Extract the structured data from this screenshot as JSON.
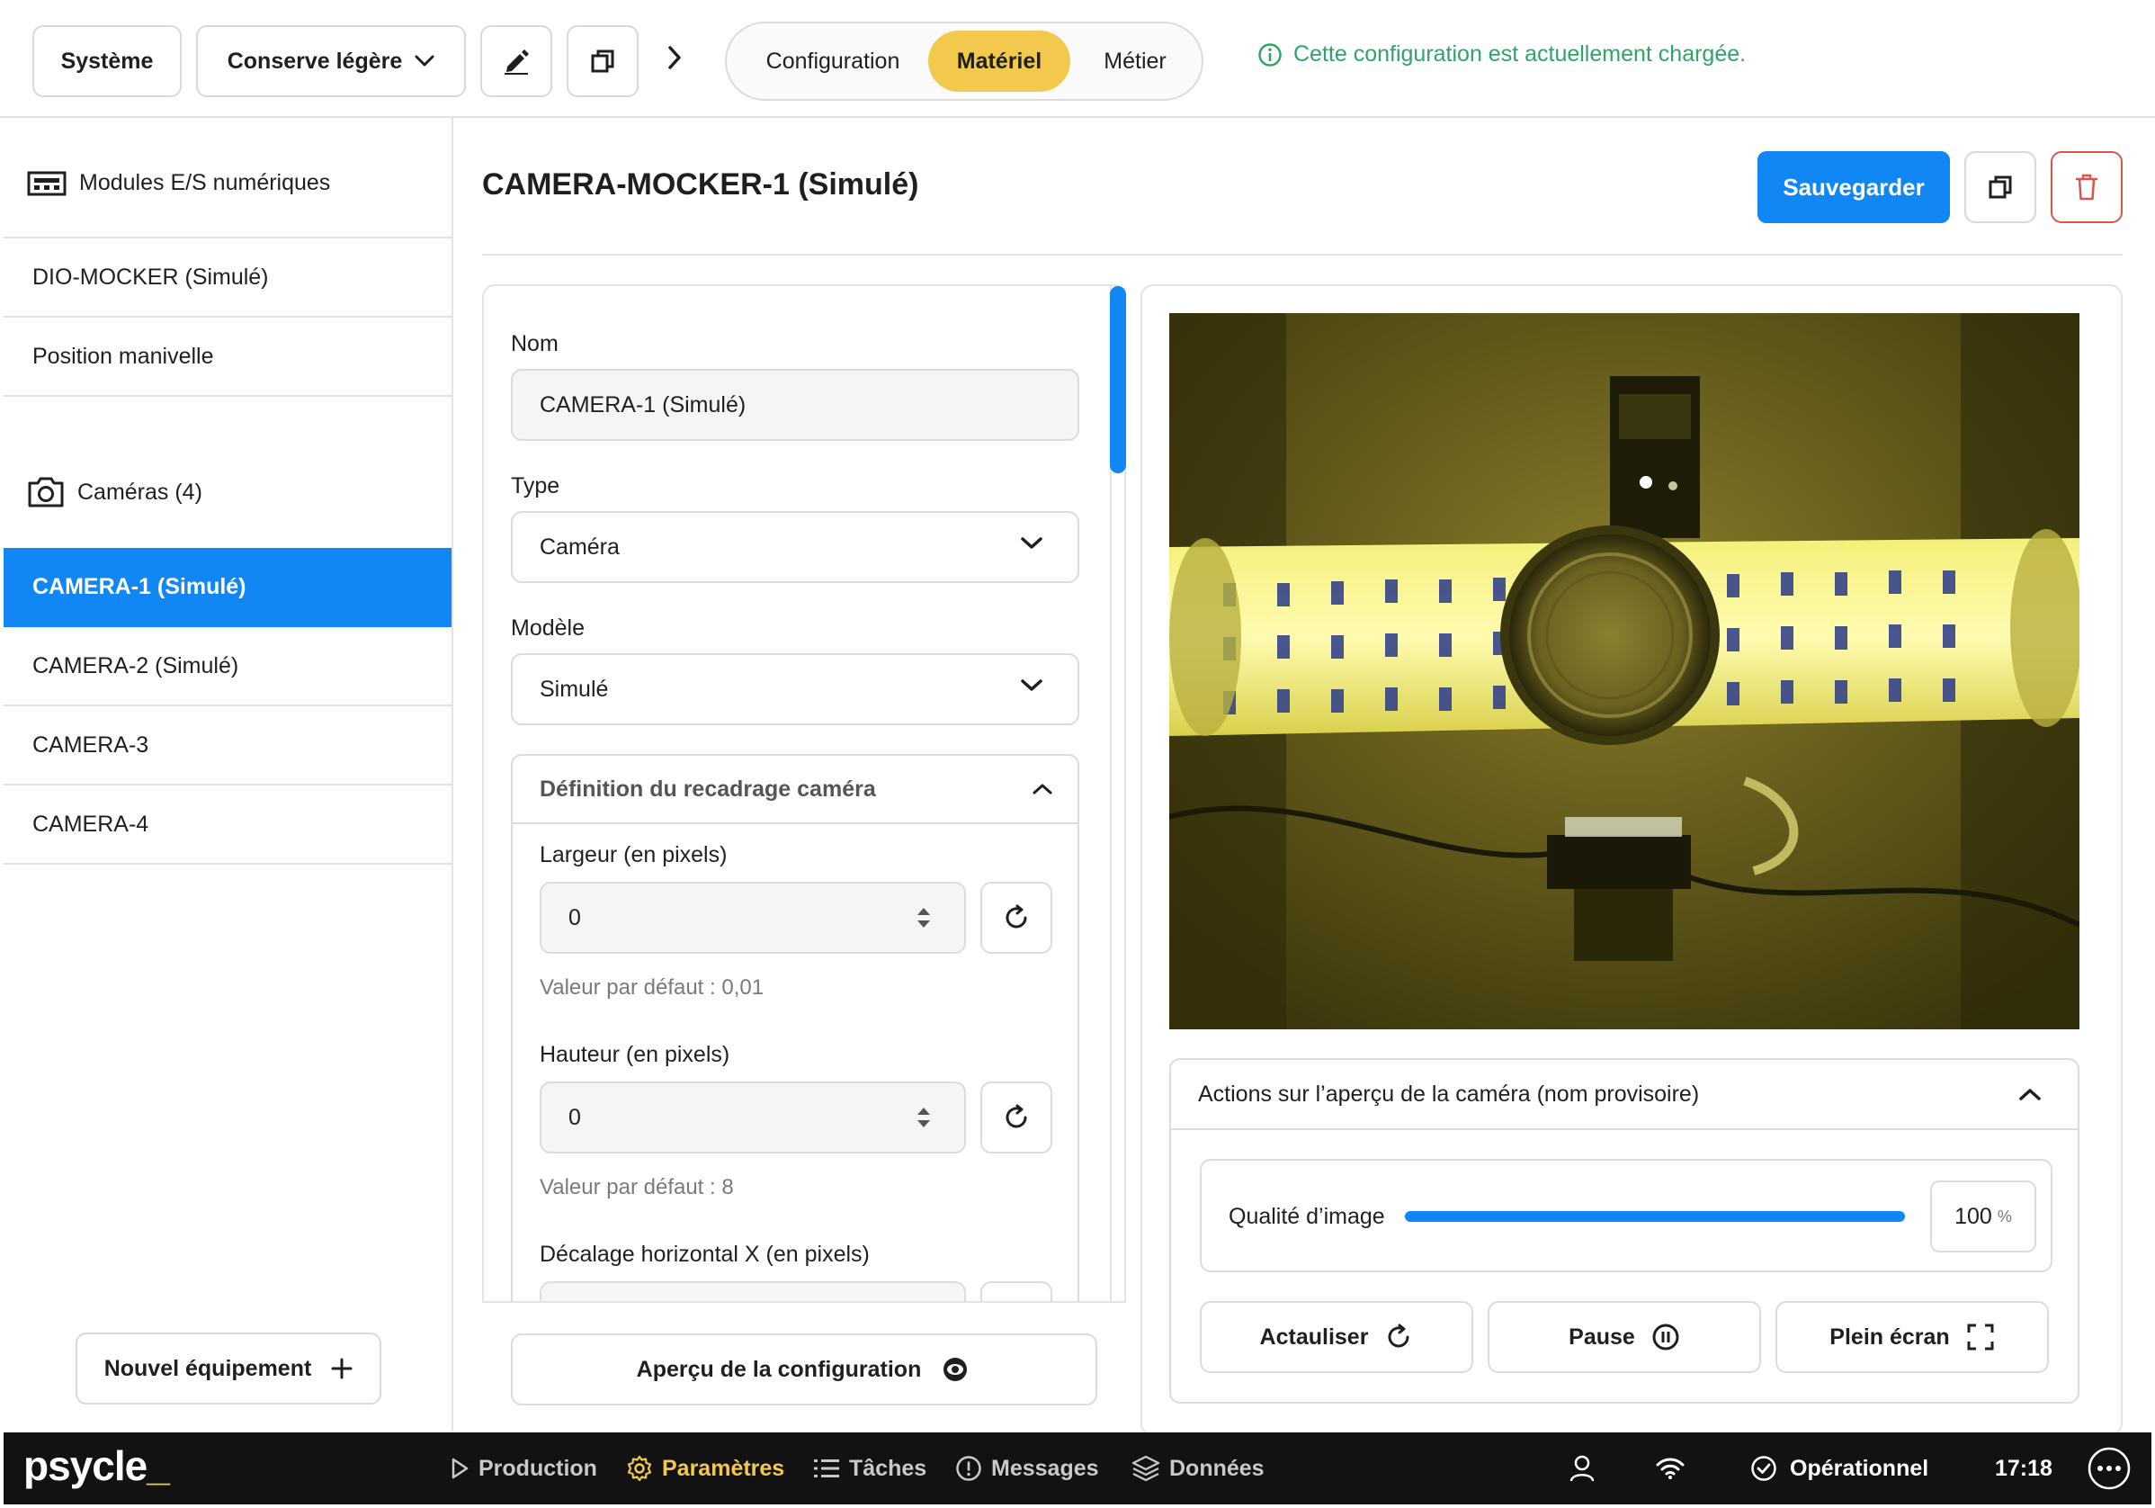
{
  "topbar": {
    "system_label": "Système",
    "config_select": "Conserve légère",
    "tabs": [
      {
        "label": "Configuration",
        "active": false
      },
      {
        "label": "Matériel",
        "active": true
      },
      {
        "label": "Métier",
        "active": false
      }
    ],
    "status_message": "Cette configuration est actuellement chargée."
  },
  "sidebar": {
    "section_io": "Modules E/S numériques",
    "io_items": [
      "DIO-MOCKER (Simulé)",
      "Position manivelle"
    ],
    "section_cameras": "Caméras (4)",
    "camera_items": [
      {
        "label": "CAMERA-1 (Simulé)",
        "active": true
      },
      {
        "label": "CAMERA-2 (Simulé)",
        "active": false
      },
      {
        "label": "CAMERA-3",
        "active": false
      },
      {
        "label": "CAMERA-4",
        "active": false
      }
    ],
    "new_equipment": "Nouvel équipement"
  },
  "main": {
    "title": "CAMERA-MOCKER-1 (Simulé)",
    "save_label": "Sauvegarder"
  },
  "form": {
    "name_label": "Nom",
    "name_value": "CAMERA-1 (Simulé)",
    "type_label": "Type",
    "type_value": "Caméra",
    "model_label": "Modèle",
    "model_value": "Simulé",
    "crop_section": "Définition du recadrage caméra",
    "width_label": "Largeur (en pixels)",
    "width_value": "0",
    "width_default": "Valeur par défaut : 0,01",
    "height_label": "Hauteur (en pixels)",
    "height_value": "0",
    "height_default": "Valeur par défaut : 8",
    "offset_x_label": "Décalage horizontal X (en pixels)",
    "preview_label": "Aperçu de la configuration"
  },
  "camera": {
    "actions_title": "Actions sur l’aperçu de la caméra (nom provisoire)",
    "quality_label": "Qualité d’image",
    "quality_value": "100",
    "quality_unit": "%",
    "quality_fraction": 1.0,
    "refresh_label": "Actauliser",
    "pause_label": "Pause",
    "fullscreen_label": "Plein écran"
  },
  "bottombar": {
    "logo": "psycle",
    "nav": [
      {
        "label": "Production",
        "icon": "play-icon",
        "active": false
      },
      {
        "label": "Paramètres",
        "icon": "gear-icon",
        "active": true
      },
      {
        "label": "Tâches",
        "icon": "list-icon",
        "active": false
      },
      {
        "label": "Messages",
        "icon": "alert-circle-icon",
        "active": false
      },
      {
        "label": "Données",
        "icon": "layers-icon",
        "active": false
      }
    ],
    "status": "Opérationnel",
    "time": "17:18"
  },
  "colors": {
    "accent_blue": "#1087f5",
    "accent_yellow": "#f2c94c",
    "success_green": "#2fa36a",
    "danger_red": "#d9534f"
  }
}
